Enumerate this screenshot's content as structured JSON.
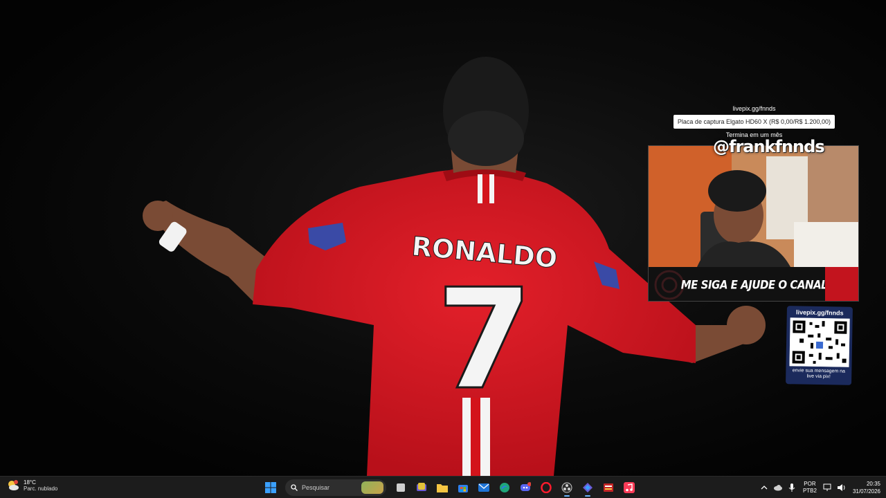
{
  "overlay": {
    "goal_link": "livepix.gg/fnnds",
    "goal_text": "Placa de captura Elgato HD60 X (R$ 0,00/R$ 1.200,00)",
    "goal_progress": 0,
    "goal_ends": "Termina em um mês",
    "handle": "@frankfnnds",
    "cta": "ME SIGA E AJUDE O CANAL",
    "qr_link": "livepix.gg/fnnds",
    "qr_message": "envie sua mensagem na live via pix!"
  },
  "wallpaper": {
    "jersey_name": "RONALDO",
    "jersey_number": "7"
  },
  "taskbar": {
    "weather_temp": "18°C",
    "weather_desc": "Parc. nublado",
    "search_placeholder": "Pesquisar",
    "apps": [
      "start-icon",
      "task-view-icon",
      "notes-icon",
      "file-explorer-icon",
      "store-icon",
      "mail-icon",
      "edge-icon",
      "discord-icon",
      "opera-icon",
      "obs-icon",
      "app-icon",
      "game-icon",
      "music-icon"
    ],
    "lang_top": "POR",
    "lang_bottom": "PTB2",
    "time": "20:35",
    "date": "31/07/2026"
  },
  "colors": {
    "jersey": "#d3141b",
    "accent": "#c3141e",
    "taskbar": "#1c1c1c"
  }
}
